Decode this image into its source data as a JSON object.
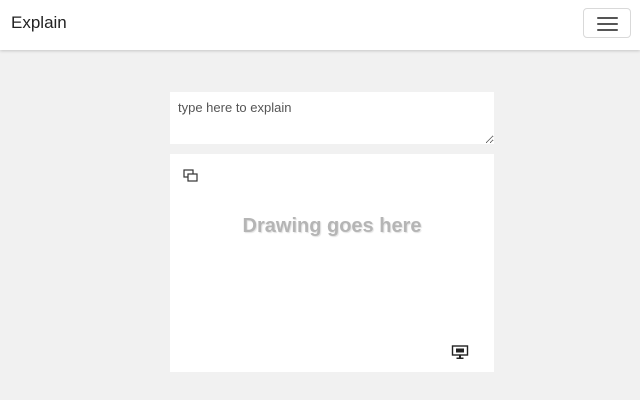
{
  "navbar": {
    "brand": "Explain",
    "menu_icon": "hamburger-menu-icon"
  },
  "explain": {
    "placeholder": "type here to explain",
    "value": ""
  },
  "drawing": {
    "placeholder": "Drawing goes here",
    "top_icon": "copy-icon",
    "bottom_icon": "present-screen-icon"
  }
}
